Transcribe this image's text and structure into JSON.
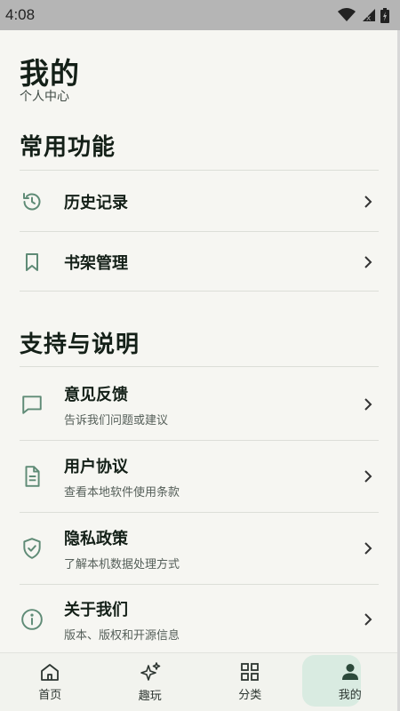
{
  "status": {
    "time": "4:08"
  },
  "header": {
    "title": "我的",
    "subtitle": "个人中心"
  },
  "sections": [
    {
      "title": "常用功能",
      "items": [
        {
          "label": "历史记录",
          "icon": "history-icon"
        },
        {
          "label": "书架管理",
          "icon": "bookmark-icon"
        }
      ]
    },
    {
      "title": "支持与说明",
      "items": [
        {
          "label": "意见反馈",
          "desc": "告诉我们问题或建议",
          "icon": "feedback-icon"
        },
        {
          "label": "用户协议",
          "desc": "查看本地软件使用条款",
          "icon": "document-icon"
        },
        {
          "label": "隐私政策",
          "desc": "了解本机数据处理方式",
          "icon": "shield-check-icon"
        },
        {
          "label": "关于我们",
          "desc": "版本、版权和开源信息",
          "icon": "info-icon"
        }
      ]
    }
  ],
  "nav": {
    "items": [
      {
        "label": "首页",
        "icon": "home-icon"
      },
      {
        "label": "趣玩",
        "icon": "sparkle-icon"
      },
      {
        "label": "分类",
        "icon": "grid-icon"
      },
      {
        "label": "我的",
        "icon": "person-icon",
        "active": true
      }
    ]
  },
  "colors": {
    "accent": "#5f8b76",
    "active_pill": "#d9ebe1",
    "background": "#f6f6f2"
  }
}
